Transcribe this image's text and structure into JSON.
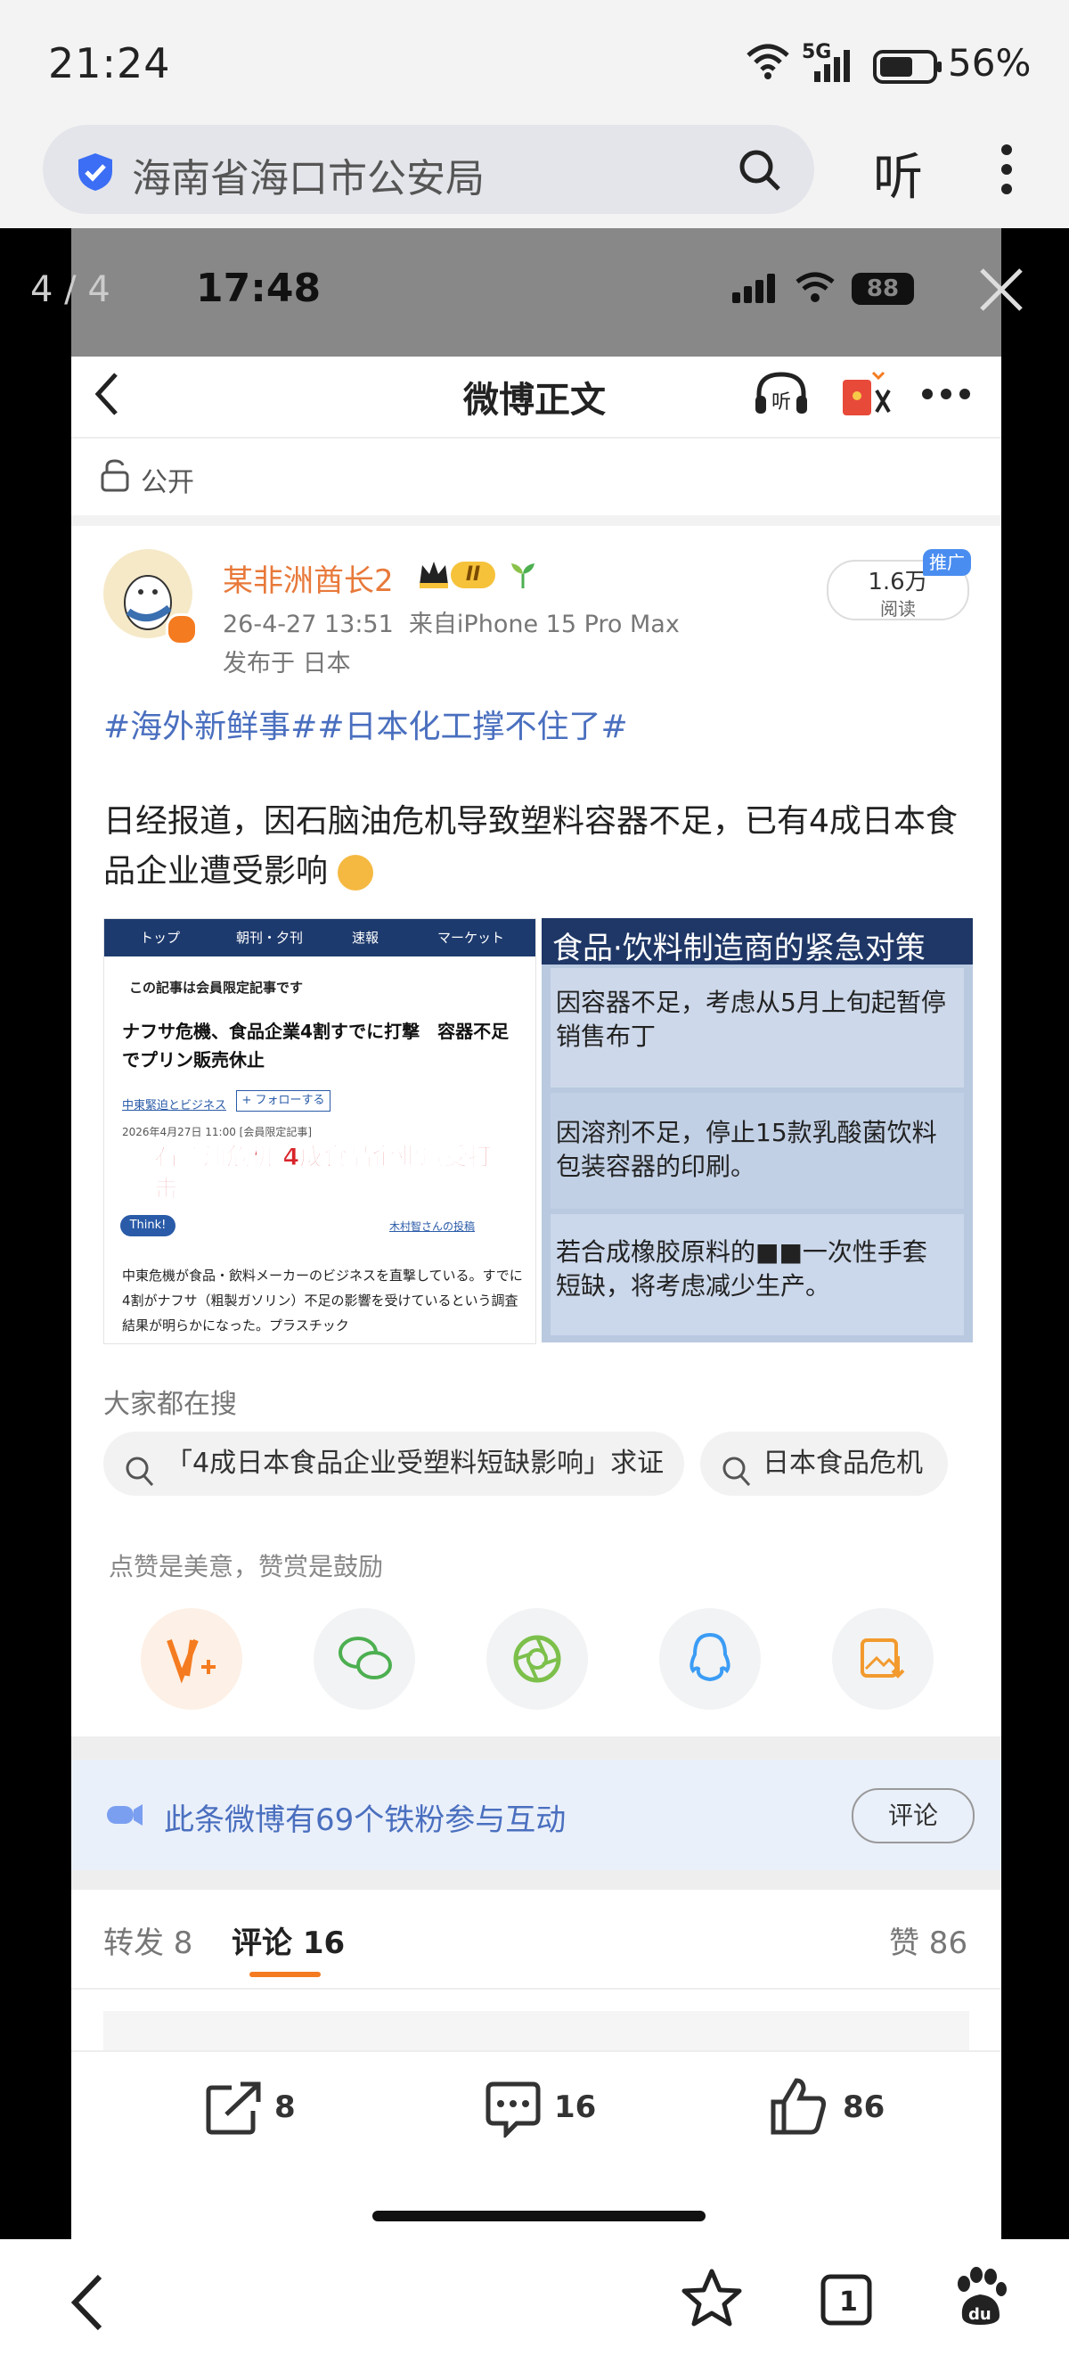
{
  "outer_status": {
    "time": "21:24",
    "network": "5G",
    "battery": "56%"
  },
  "browser": {
    "search_text": "海南省海口市公安局",
    "listen_label": "听"
  },
  "viewer": {
    "page_counter": "4 / 4"
  },
  "inner_status": {
    "time": "17:48",
    "battery": "88"
  },
  "header": {
    "title": "微博正文"
  },
  "visibility": "公开",
  "post": {
    "author": "某非洲酋长2",
    "level_badge": "II",
    "datetime_source": "26-4-27 13:51  来自iPhone 15 Pro Max",
    "location": "发布于 日本",
    "read_count": "1.6万",
    "read_label": "阅读",
    "promo_badge": "推广",
    "hashtags": "#海外新鲜事##日本化工撑不住了#",
    "body": "日经报道，因石脑油危机导致塑料容器不足，已有4成日本食品企业遭受影响"
  },
  "left_image": {
    "tabs": [
      "トップ",
      "朝刊・夕刊",
      "速報",
      "マーケット"
    ],
    "members_only": "この記事は会員限定記事です",
    "headline": "ナフサ危機、食品企業4割すでに打撃　容器不足でプリン販売休止",
    "topic": "中東緊迫とビジネス",
    "follow": "+ フォローする",
    "date": "2026年4月27日 11:00 [会員限定記事]",
    "overlay": "石脑油危机 4成食品企业遭受打击",
    "think": "Think!",
    "commenter": "木村智さんの投稿",
    "body": "中東危機が食品・飲料メーカーのビジネスを直撃している。すでに4割がナフサ（粗製ガソリン）不足の影響を受けているという調査結果が明らかになった。プラスチック"
  },
  "right_image": {
    "title": "食品·饮料制造商的紧急对策",
    "items": [
      "因容器不足，考虑从5月上旬起暂停销售布丁",
      "因溶剂不足，停止15款乳酸菌饮料包装容器的印刷。",
      "若合成橡胶原料的■■一次性手套短缺，将考虑减少生产。"
    ]
  },
  "search_section": {
    "title": "大家都在搜",
    "chips": [
      "「4成日本食品企业受塑料短缺影响」求证",
      "日本食品危机"
    ]
  },
  "reward_text": "点赞是美意，赞赏是鼓励",
  "fans_bar": {
    "text": "此条微博有69个铁粉参与互动",
    "button": "评论"
  },
  "tabs": {
    "repost": "转发 8",
    "comment": "评论 16",
    "like": "赞 86"
  },
  "bottom_bar": {
    "repost": "8",
    "comment": "16",
    "like": "86"
  },
  "colors": {
    "accent": "#f47b20",
    "link": "#4a6fbf",
    "orange_name": "#e8793a"
  }
}
